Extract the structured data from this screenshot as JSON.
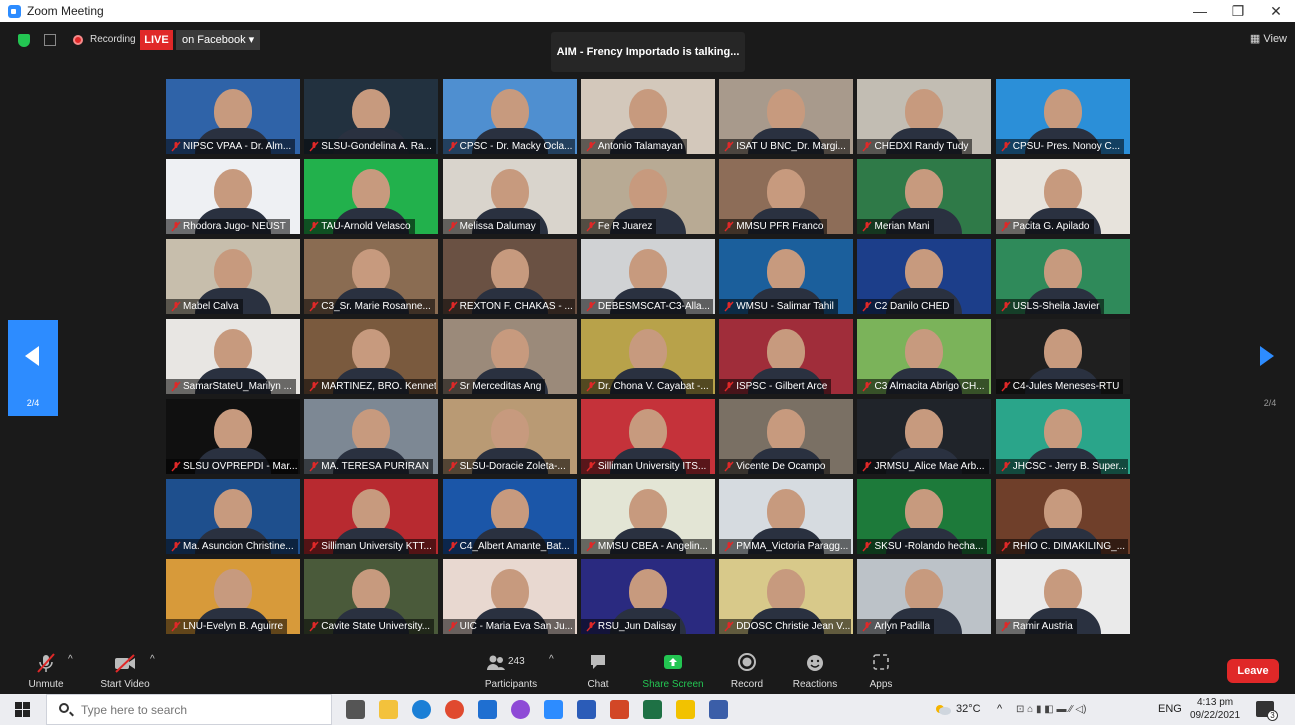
{
  "window": {
    "title": "Zoom Meeting",
    "controls": [
      "—",
      "❐",
      "✕"
    ]
  },
  "topbar": {
    "recording_label": "Recording",
    "live_badge": "LIVE",
    "stream_target": "on Facebook ▾",
    "active_speaker": "AIM - Frency Importado is talking...",
    "view_label": "▦ View"
  },
  "pager": {
    "left_label": "2/4",
    "right_label": "2/4"
  },
  "participants_tiles": [
    {
      "name": "NIPSC VPAA - Dr. Alm...",
      "bg": "#2f63a8"
    },
    {
      "name": "SLSU-Gondelina A. Ra...",
      "bg": "#22313f"
    },
    {
      "name": "CPSC - Dr. Macky Ocla...",
      "bg": "#4f8fd0"
    },
    {
      "name": "Antonio Talamayan",
      "bg": "#d3c8bb"
    },
    {
      "name": "ISAT U BNC_Dr. Margi...",
      "bg": "#a89a8c"
    },
    {
      "name": "CHEDXI Randy Tudy",
      "bg": "#c2bdb3"
    },
    {
      "name": "CPSU- Pres. Nonoy C...",
      "bg": "#2b8fd8"
    },
    {
      "name": "Rhodora Jugo- NEUST",
      "bg": "#eef0f3"
    },
    {
      "name": "TAU-Arnold Velasco",
      "bg": "#22b14c"
    },
    {
      "name": "Melissa Dalumay",
      "bg": "#d9d4cc"
    },
    {
      "name": "Fe R Juarez",
      "bg": "#b8aa94"
    },
    {
      "name": "MMSU PFR Franco",
      "bg": "#8d6d58"
    },
    {
      "name": "Merian Mani",
      "bg": "#2f7a48"
    },
    {
      "name": "Pacita G. Apilado",
      "bg": "#e7e3dc"
    },
    {
      "name": "Mabel Calva",
      "bg": "#c7beac"
    },
    {
      "name": "C3_Sr. Marie Rosanne...",
      "bg": "#8a6c52"
    },
    {
      "name": "REXTON F. CHAKAS - ...",
      "bg": "#6a5143"
    },
    {
      "name": "DEBESMSCAT-C3-Alla...",
      "bg": "#d0d2d4"
    },
    {
      "name": "WMSU - Salimar Tahil",
      "bg": "#1b5f9c"
    },
    {
      "name": "C2 Danilo CHED",
      "bg": "#1c3e8a"
    },
    {
      "name": "USLS-Sheila Javier",
      "bg": "#2f8a5a"
    },
    {
      "name": "SamarStateU_Marilyn ...",
      "bg": "#e8e6e3"
    },
    {
      "name": "MARTINEZ, BRO. Kenneth",
      "bg": "#7a5a3e"
    },
    {
      "name": "Sr Merceditas Ang",
      "bg": "#9b8a7a"
    },
    {
      "name": "Dr. Chona V. Cayabat -...",
      "bg": "#b8a24a"
    },
    {
      "name": "ISPSC - Gilbert Arce",
      "bg": "#a02d3a"
    },
    {
      "name": "C3 Almacita Abrigo CH...",
      "bg": "#7bb35a"
    },
    {
      "name": "C4-Jules Meneses-RTU",
      "bg": "#1f1f1f"
    },
    {
      "name": "SLSU OVPREPDI - Mar...",
      "bg": "#101010"
    },
    {
      "name": "MA. TERESA PURIRAN",
      "bg": "#7d8894"
    },
    {
      "name": "SLSU-Doracie Zoleta-...",
      "bg": "#b99a74"
    },
    {
      "name": "Silliman University ITS...",
      "bg": "#c5323a"
    },
    {
      "name": "Vicente De Ocampo",
      "bg": "#7a7064"
    },
    {
      "name": "JRMSU_Alice Mae Arb...",
      "bg": "#20242a"
    },
    {
      "name": "JHCSC - Jerry B. Super...",
      "bg": "#2aa58a"
    },
    {
      "name": "Ma. Asuncion Christine...",
      "bg": "#1e4f8d"
    },
    {
      "name": "Silliman University KTT...",
      "bg": "#b82a30"
    },
    {
      "name": "C4_Albert Amante_Bat...",
      "bg": "#1b56a8"
    },
    {
      "name": "MMSU CBEA - Angelin...",
      "bg": "#e3e5d5"
    },
    {
      "name": "PMMA_Victoria Paragg...",
      "bg": "#d6dbe0"
    },
    {
      "name": "SKSU -Rolando hecha...",
      "bg": "#1d7a3a"
    },
    {
      "name": "RHIO C. DIMAKILING_...",
      "bg": "#6f3f2a"
    },
    {
      "name": "LNU-Evelyn B. Aguirre",
      "bg": "#d79a3a"
    },
    {
      "name": "Cavite State University...",
      "bg": "#4a5a3a"
    },
    {
      "name": "UIC - Maria Eva San Ju...",
      "bg": "#e8d8d0"
    },
    {
      "name": "RSU_Jun Dalisay",
      "bg": "#2a2a80"
    },
    {
      "name": "DDOSC Christie Jean V...",
      "bg": "#d8c98a"
    },
    {
      "name": "Arlyn Padilla",
      "bg": "#bcc2c8"
    },
    {
      "name": "Ramir Austria",
      "bg": "#eaeaea"
    }
  ],
  "controls": {
    "unmute": "Unmute",
    "start_video": "Start Video",
    "participants_count": "243",
    "participants": "Participants",
    "chat": "Chat",
    "share_screen": "Share Screen",
    "record": "Record",
    "reactions": "Reactions",
    "apps": "Apps",
    "leave": "Leave"
  },
  "taskbar": {
    "search_placeholder": "Type here to search",
    "weather": "32°C",
    "language": "ENG",
    "time": "4:13 pm",
    "date": "09/22/2021",
    "notif_count": "3",
    "icons": [
      "task-view-icon",
      "file-explorer-icon",
      "edge-icon",
      "chrome-icon",
      "mail-icon",
      "messenger-icon",
      "zoom-icon",
      "word-icon",
      "powerpoint-icon",
      "excel-icon",
      "sticky-notes-icon",
      "calculator-icon"
    ]
  },
  "colors": {
    "accent": "#2d8cff",
    "live": "#e02828",
    "share": "#23c552",
    "leave": "#e02828"
  }
}
